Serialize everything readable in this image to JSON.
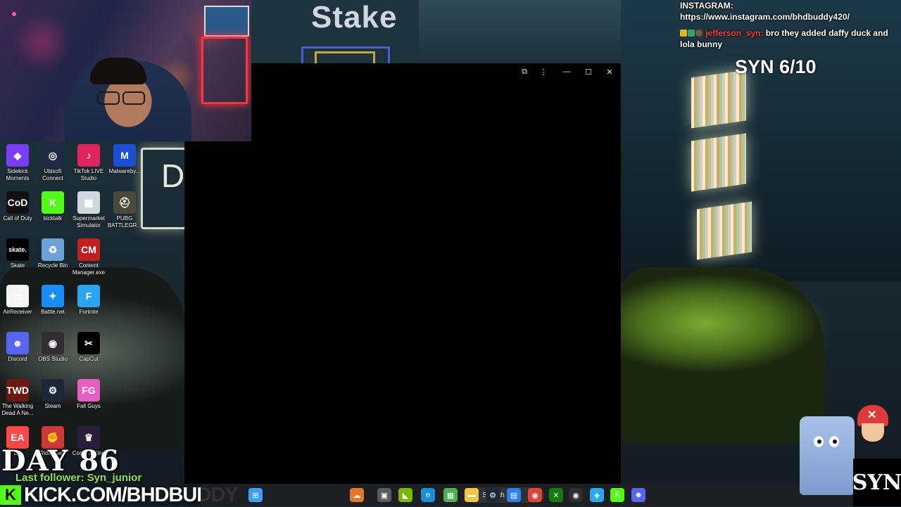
{
  "window_controls": {
    "snap": "⧉",
    "more": "⋮",
    "minimize": "—",
    "maximize": "☐",
    "close": "✕"
  },
  "overlay": {
    "stake_logo": "Stake",
    "wall_sign": "D",
    "instagram_label": "INSTAGRAM:",
    "instagram_url": "https://www.instagram.com/bhdbuddy420/",
    "chat": {
      "username": "jefferson_syn:",
      "message": "bro they added daffy duck and lola bunny"
    },
    "rating": "SYN 6/10",
    "day_counter": "DAY 86",
    "last_follower": "Last follower: Syn_junior",
    "kick_logo": "K",
    "kick_url": "KICK.COM/BHDBUDDY",
    "syn_logo": "SYN"
  },
  "desktop_icons": [
    {
      "label": "Sidekick Moments",
      "icon": "sidekick-icon",
      "color": "#7a3cff",
      "glyph": "◆"
    },
    {
      "label": "Ubisoft Connect",
      "icon": "ubisoft-icon",
      "color": "#1f2a44",
      "glyph": "◎"
    },
    {
      "label": "TikTok LIVE Studio",
      "icon": "tiktok-icon",
      "color": "#e0245e",
      "glyph": "♪"
    },
    {
      "label": "Malwareby...",
      "icon": "malwarebytes-icon",
      "color": "#1a4fd6",
      "glyph": "M"
    },
    {
      "label": "Call of Duty",
      "icon": "call-of-duty-icon",
      "color": "#111111",
      "glyph": "CoD"
    },
    {
      "label": "kicktalk",
      "icon": "kicktalk-icon",
      "color": "#53fc18",
      "glyph": "K"
    },
    {
      "label": "Supermarket Simulator",
      "icon": "supermarket-icon",
      "color": "#cfd8dc",
      "glyph": "▦"
    },
    {
      "label": "PUBG BATTLEGR...",
      "icon": "pubg-icon",
      "color": "#4a4a3a",
      "glyph": "⛑"
    },
    {
      "label": "Skate",
      "icon": "skate-icon",
      "color": "#000000",
      "glyph": "skate."
    },
    {
      "label": "Recycle Bin",
      "icon": "recycle-bin-icon",
      "color": "#6fa3d8",
      "glyph": "♻"
    },
    {
      "label": "Content Manager.exe",
      "icon": "content-manager-icon",
      "color": "#c41f1f",
      "glyph": "CM"
    },
    {
      "label": "AirReceiver",
      "icon": "airreceiver-icon",
      "color": "#f5f5f5",
      "glyph": "▭"
    },
    {
      "label": "Battle.net",
      "icon": "battlenet-icon",
      "color": "#148eff",
      "glyph": "✦"
    },
    {
      "label": "Fortnite",
      "icon": "fortnite-icon",
      "color": "#2aa6f0",
      "glyph": "F"
    },
    {
      "label": "Discord",
      "icon": "discord-icon",
      "color": "#5865f2",
      "glyph": "☻"
    },
    {
      "label": "OBS Studio",
      "icon": "obs-icon",
      "color": "#302e31",
      "glyph": "◉"
    },
    {
      "label": "CapCut",
      "icon": "capcut-icon",
      "color": "#000000",
      "glyph": "✂"
    },
    {
      "label": "The Walking Dead A Ne...",
      "icon": "walking-dead-icon",
      "color": "#6b1a12",
      "glyph": "TWD"
    },
    {
      "label": "Steam",
      "icon": "steam-icon",
      "color": "#1b2838",
      "glyph": "⚙"
    },
    {
      "label": "Fall Guys",
      "icon": "fall-guys-icon",
      "color": "#e75fc4",
      "glyph": "FG"
    },
    {
      "label": "EA",
      "icon": "ea-icon",
      "color": "#ff4747",
      "glyph": "EA"
    },
    {
      "label": "Riot Client",
      "icon": "riot-client-icon",
      "color": "#d13639",
      "glyph": "✊"
    },
    {
      "label": "Content King",
      "icon": "content-king-icon",
      "color": "#2a1d3a",
      "glyph": "♛"
    }
  ],
  "taskbar": {
    "search_placeholder": "Search",
    "items": [
      {
        "name": "start-button",
        "icon": "windows-start-icon",
        "color": "#3aa0ff",
        "glyph": "⊞"
      },
      {
        "name": "taskbar-weather",
        "icon": "weather-widget-icon",
        "color": "#e2782a",
        "glyph": "☁"
      },
      {
        "name": "taskbar-task-view",
        "icon": "task-view-icon",
        "color": "#5a5a5a",
        "glyph": "▣"
      },
      {
        "name": "taskbar-nvidia",
        "icon": "nvidia-icon",
        "color": "#76b900",
        "glyph": "◣"
      },
      {
        "name": "taskbar-edge",
        "icon": "edge-icon",
        "color": "#1a8fd8",
        "glyph": "e"
      },
      {
        "name": "taskbar-minecraft",
        "icon": "minecraft-icon",
        "color": "#4caf50",
        "glyph": "▦"
      },
      {
        "name": "taskbar-file-explorer",
        "icon": "folder-icon",
        "color": "#f5c542",
        "glyph": "▬"
      },
      {
        "name": "taskbar-steam",
        "icon": "steam-icon",
        "color": "#1b2838",
        "glyph": "⚙"
      },
      {
        "name": "taskbar-store",
        "icon": "microsoft-store-icon",
        "color": "#2d7df6",
        "glyph": "▤"
      },
      {
        "name": "taskbar-chrome",
        "icon": "chrome-icon",
        "color": "#db4437",
        "glyph": "◉"
      },
      {
        "name": "taskbar-xbox",
        "icon": "xbox-icon",
        "color": "#107c10",
        "glyph": "✕"
      },
      {
        "name": "taskbar-obs",
        "icon": "obs-icon",
        "color": "#302e31",
        "glyph": "◉"
      },
      {
        "name": "taskbar-app",
        "icon": "app-icon",
        "color": "#2aa6f0",
        "glyph": "◈"
      },
      {
        "name": "taskbar-kick",
        "icon": "kick-icon",
        "color": "#53fc18",
        "glyph": "K"
      },
      {
        "name": "taskbar-discord",
        "icon": "discord-icon",
        "color": "#5865f2",
        "glyph": "☻"
      }
    ]
  }
}
